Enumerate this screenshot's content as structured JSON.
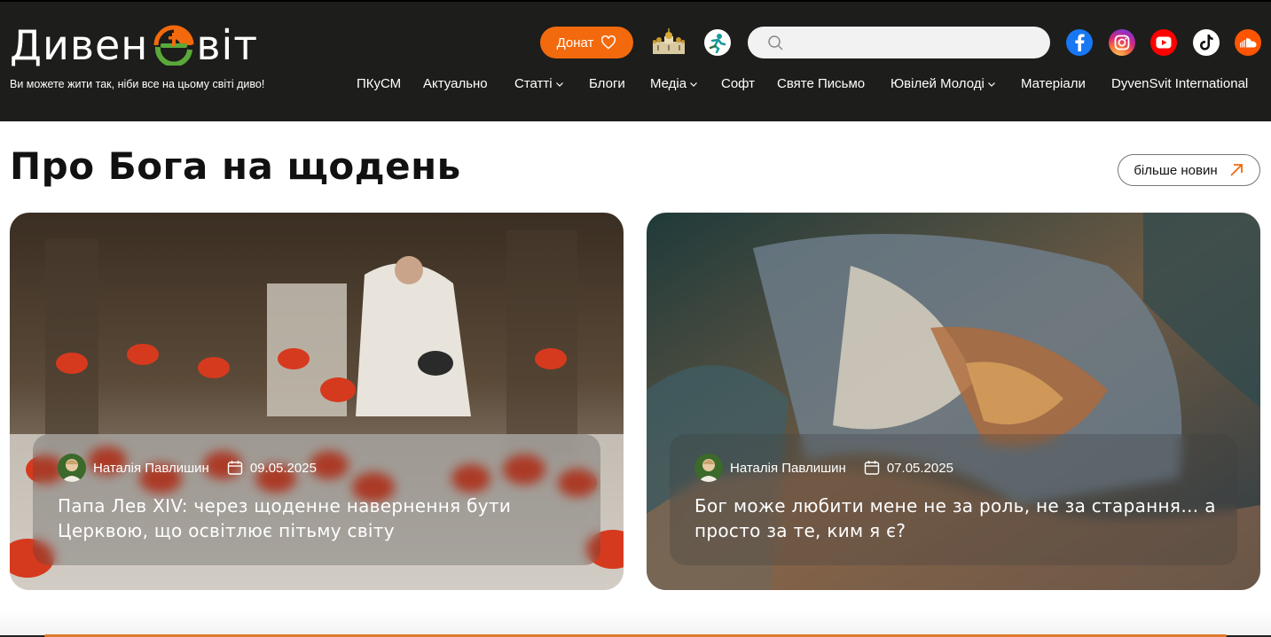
{
  "header": {
    "logo_left": "Дивен",
    "logo_right": "віт",
    "tagline": "Ви можете жити так, ніби все на цьому світі диво!",
    "donate_label": "Донат",
    "search": {
      "placeholder": ""
    },
    "nav": [
      {
        "label": "ПКуСМ",
        "dropdown": false
      },
      {
        "label": "Актуально",
        "dropdown": false
      },
      {
        "label": "Статті",
        "dropdown": true
      },
      {
        "label": "Блоги",
        "dropdown": false
      },
      {
        "label": "Медіа",
        "dropdown": true
      },
      {
        "label": "Софт",
        "dropdown": false
      },
      {
        "label": "Святе Письмо",
        "dropdown": false
      },
      {
        "label": "Ювілей Молоді",
        "dropdown": true
      },
      {
        "label": "Матеріали",
        "dropdown": false
      },
      {
        "label": "DyvenSvit International",
        "dropdown": false
      }
    ],
    "social_icons": [
      "facebook-icon",
      "instagram-icon",
      "youtube-icon",
      "tiktok-icon",
      "soundcloud-icon"
    ]
  },
  "section": {
    "title": "Про Бога на щодень",
    "more_label": "більше новин"
  },
  "cards": [
    {
      "author": "Наталія Павлишин",
      "date": "09.05.2025",
      "headline": "Папа Лев XIV: через щоденне навернення бути Церквою, що освітлює пітьму світу"
    },
    {
      "author": "Наталія Павлишин",
      "date": "07.05.2025",
      "headline": "Бог може любити мене не за роль, не за старання… а просто за те, ким я є?"
    }
  ],
  "colors": {
    "header_bg": "#1d1d1b",
    "accent": "#f26a0d",
    "logo_green": "#5aa83a"
  }
}
